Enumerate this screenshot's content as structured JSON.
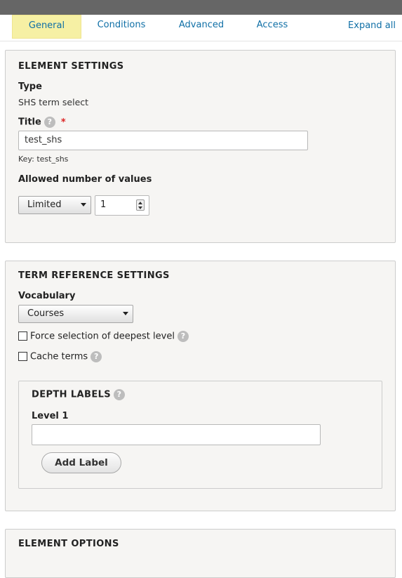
{
  "tabs": [
    {
      "label": "General"
    },
    {
      "label": "Conditions"
    },
    {
      "label": "Advanced"
    },
    {
      "label": "Access"
    }
  ],
  "expand_all_label": "Expand all",
  "element_settings": {
    "legend": "ELEMENT SETTINGS",
    "type_label": "Type",
    "type_value": "SHS term select",
    "title_label": "Title",
    "title_value": "test_shs",
    "key_text": "Key: test_shs",
    "allowed_label": "Allowed number of values",
    "allowed_select": "Limited",
    "allowed_number": "1"
  },
  "term_reference_settings": {
    "legend": "TERM REFERENCE SETTINGS",
    "vocabulary_label": "Vocabulary",
    "vocabulary_value": "Courses",
    "force_label": "Force selection of deepest level",
    "cache_label": "Cache terms",
    "depth_labels": {
      "legend": "DEPTH LABELS",
      "level1_label": "Level 1",
      "level1_value": "",
      "add_label_button": "Add Label"
    }
  },
  "element_options": {
    "legend": "ELEMENT OPTIONS"
  },
  "help_icon_text": "?",
  "required_mark": "*",
  "colors": {
    "link": "#0f6fa6",
    "active_tab_bg": "#f6f0a4",
    "required": "#dc2323",
    "topbar": "#666666"
  }
}
